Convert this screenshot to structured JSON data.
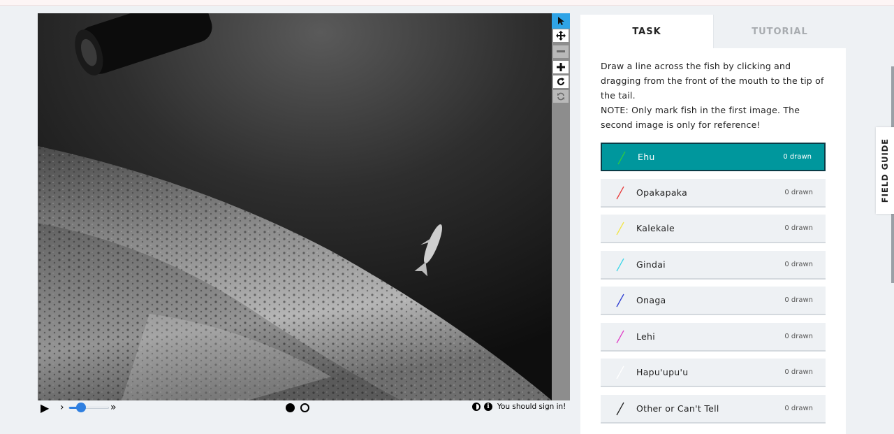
{
  "tabs": {
    "task": "TASK",
    "tutorial": "TUTORIAL"
  },
  "instructions": {
    "line1": "Draw a line across the fish by clicking and dragging from the front of the mouth to the tip of the tail.",
    "line2": "NOTE: Only mark fish in the first image. The second image is only for reference!"
  },
  "tools": {
    "pointer": "pointer-icon",
    "pan": "move-icon",
    "zoom_out": "minus-icon",
    "zoom_in": "plus-icon",
    "rotate": "rotate-icon",
    "reset": "reset-icon"
  },
  "options": [
    {
      "label": "Ehu",
      "count": "0 drawn",
      "color": "#2ecc40",
      "selected": true
    },
    {
      "label": "Opakapaka",
      "count": "0 drawn",
      "color": "#e83a3a",
      "selected": false
    },
    {
      "label": "Kalekale",
      "count": "0 drawn",
      "color": "#f2e544",
      "selected": false
    },
    {
      "label": "Gindai",
      "count": "0 drawn",
      "color": "#3ad6e8",
      "selected": false
    },
    {
      "label": "Onaga",
      "count": "0 drawn",
      "color": "#2b3ad1",
      "selected": false
    },
    {
      "label": "Lehi",
      "count": "0 drawn",
      "color": "#e040c8",
      "selected": false
    },
    {
      "label": "Hapu'upu'u",
      "count": "0 drawn",
      "color": "#ffffff",
      "selected": false
    },
    {
      "label": "Other or Can't Tell",
      "count": "0 drawn",
      "color": "#222222",
      "selected": false
    }
  ],
  "controls": {
    "play": "▶",
    "slower": "›",
    "faster": "»",
    "speed_fraction": 0.2,
    "frames": 2,
    "current_frame": 1,
    "sign_in": "You should sign in!"
  },
  "field_guide": "FIELD GUIDE"
}
